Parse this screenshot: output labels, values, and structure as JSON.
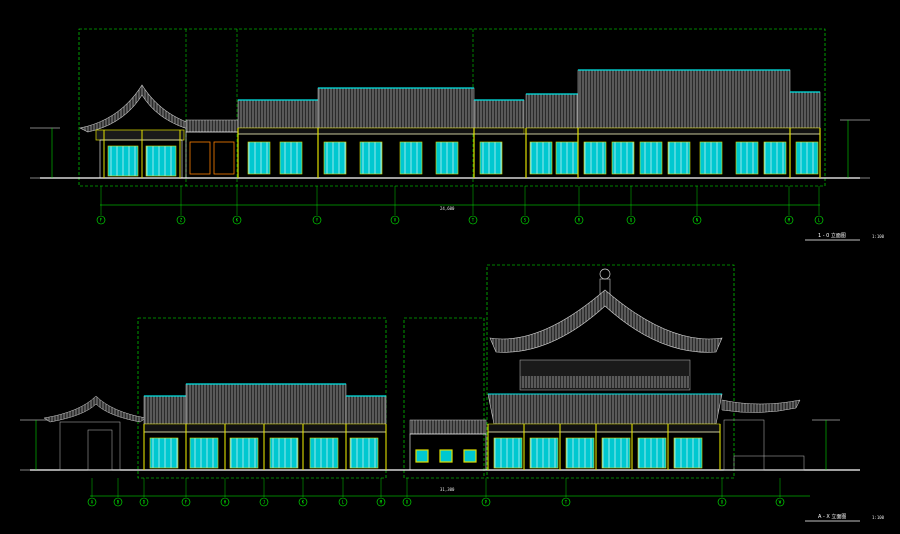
{
  "drawings": [
    {
      "title": "1 - 0 立面图",
      "scale": "1:100",
      "axes": [
        "F",
        "Z",
        "K",
        "Y",
        "V",
        "T",
        "S",
        "R",
        "Q",
        "N",
        "M",
        "L",
        "K"
      ],
      "total_dim": "24,600"
    },
    {
      "title": "A - X 立面图",
      "scale": "1:100",
      "axes": [
        "A",
        "B",
        "D",
        "F",
        "H",
        "J",
        "K",
        "L",
        "M",
        "O",
        "P",
        "T",
        "U",
        "W",
        "Y"
      ],
      "total_dim": "31,300"
    }
  ],
  "colors": {
    "background": "#000000",
    "roof": "#9a9a9a",
    "ridge": "#00e5e5",
    "window": "#00e5e5",
    "column": "#e0e000",
    "wall": "#ffffff",
    "dim": "#00ff00",
    "door": "#ff8000"
  }
}
